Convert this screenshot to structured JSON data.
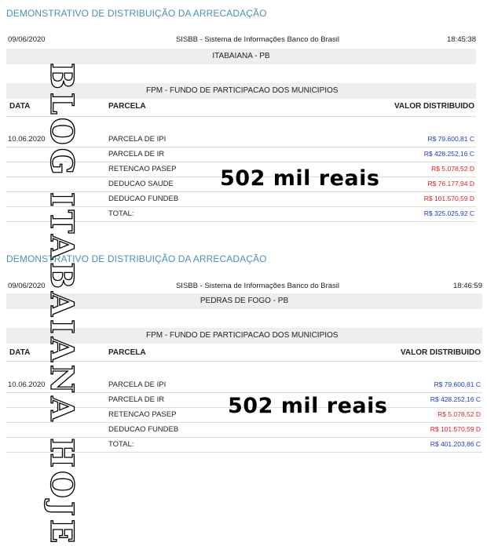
{
  "reports": [
    {
      "title": "DEMONSTRATIVO DE DISTRIBUIÇÃO DA ARRECADAÇÃO",
      "date": "09/06/2020",
      "system": "SISBB - Sistema de Informações Banco do Brasil",
      "time": "18:45:38",
      "municipality": "ITABAIANA - PB",
      "fund": "FPM - FUNDO DE PARTICIPACAO DOS MUNICIPIOS",
      "columns": {
        "date": "DATA",
        "parcela": "PARCELA",
        "valor": "VALOR DISTRIBUIDO"
      },
      "rows": [
        {
          "date": "10.06.2020",
          "parcela": "PARCELA DE IPI",
          "valor": "R$ 79.600,81 C",
          "type": "C"
        },
        {
          "date": "",
          "parcela": "PARCELA DE IR",
          "valor": "R$ 428.252,16 C",
          "type": "C"
        },
        {
          "date": "",
          "parcela": "RETENCAO PASEP",
          "valor": "R$ 5.078,52 D",
          "type": "D"
        },
        {
          "date": "",
          "parcela": "DEDUCAO SAUDE",
          "valor": "R$ 76.177,94 D",
          "type": "D"
        },
        {
          "date": "",
          "parcela": "DEDUCAO FUNDEB",
          "valor": "R$ 101.570,59 D",
          "type": "D"
        },
        {
          "date": "",
          "parcela": "TOTAL:",
          "valor": "R$ 325.025,92 C",
          "type": "C"
        }
      ],
      "overlay_text": "502 mil reais"
    },
    {
      "title": "DEMONSTRATIVO DE DISTRIBUIÇÃO DA ARRECADAÇÃO",
      "date": "09/06/2020",
      "system": "SISBB - Sistema de Informações Banco do Brasil",
      "time": "18:46:59",
      "municipality": "PEDRAS DE FOGO - PB",
      "fund": "FPM - FUNDO DE PARTICIPACAO DOS MUNICIPIOS",
      "columns": {
        "date": "DATA",
        "parcela": "PARCELA",
        "valor": "VALOR DISTRIBUIDO"
      },
      "rows": [
        {
          "date": "10.06.2020",
          "parcela": "PARCELA DE IPI",
          "valor": "R$ 79.600,81 C",
          "type": "C"
        },
        {
          "date": "",
          "parcela": "PARCELA DE IR",
          "valor": "R$ 428.252,16 C",
          "type": "C"
        },
        {
          "date": "",
          "parcela": "RETENCAO PASEP",
          "valor": "R$ 5.078,52 D",
          "type": "D"
        },
        {
          "date": "",
          "parcela": "DEDUCAO FUNDEB",
          "valor": "R$ 101.570,59 D",
          "type": "D"
        },
        {
          "date": "",
          "parcela": "TOTAL:",
          "valor": "R$ 401.203,86 C",
          "type": "C"
        }
      ],
      "overlay_text": "502 mil reais"
    }
  ],
  "watermark": "BLOG ITABAIANA HOJE",
  "colors": {
    "heading": "#4a8fb5",
    "credit": "#1f3cc7",
    "debit": "#e02020",
    "bar": "#eeeeee"
  }
}
